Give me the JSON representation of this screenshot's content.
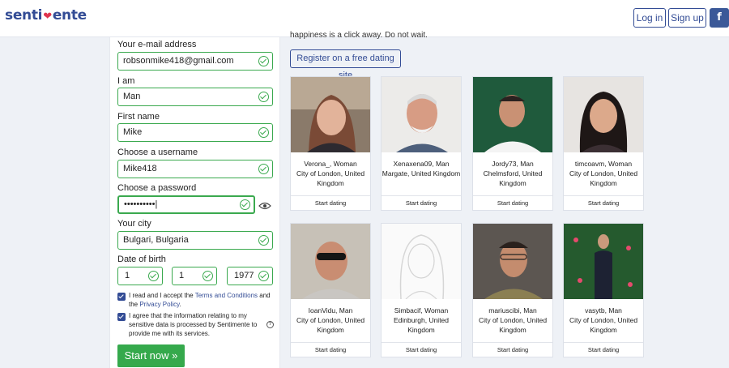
{
  "header": {
    "logo_left": "senti",
    "logo_right": "ente",
    "login_label": "Log in",
    "signup_label": "Sign up",
    "facebook_label": "f"
  },
  "form": {
    "email_label": "Your e-mail address",
    "email_value": "robsonmike418@gmail.com",
    "iam_label": "I am",
    "iam_value": "Man",
    "firstname_label": "First name",
    "firstname_value": "Mike",
    "username_label": "Choose a username",
    "username_value": "Mike418",
    "password_label": "Choose a password",
    "password_value": "••••••••••|",
    "city_label": "Your city",
    "city_value": "Bulgari, Bulgaria",
    "dob_label": "Date of birth",
    "dob_day": "1",
    "dob_month": "1",
    "dob_year": "1977",
    "terms_prefix": "I read and I accept the ",
    "terms_link": "Terms and Conditions",
    "terms_middle": " and the ",
    "privacy_link": "Privacy Policy",
    "terms_suffix": ".",
    "consent_text": "I agree that the information relating to my sensitive data is processed by Sentimente to provide me with its services.",
    "help_label": "?",
    "start_label": "Start now »"
  },
  "main": {
    "tagline": "happiness is a click away. Do not wait.",
    "register_label": "Register on a free dating site",
    "start_dating_label": "Start dating",
    "profiles": [
      {
        "name": "Verona_, Woman",
        "location": "City of London, United Kingdom"
      },
      {
        "name": "Xenaxena09, Man",
        "location": "Margate, United Kingdom"
      },
      {
        "name": "Jordy73, Man",
        "location": "Chelmsford, United Kingdom"
      },
      {
        "name": "timcoavm, Woman",
        "location": "City of London, United Kingdom"
      },
      {
        "name": "IoanVidu, Man",
        "location": "City of London, United Kingdom"
      },
      {
        "name": "Simbacif, Woman",
        "location": "Edinburgh, United Kingdom"
      },
      {
        "name": "mariuscibi, Man",
        "location": "City of London, United Kingdom"
      },
      {
        "name": "vasytb, Man",
        "location": "City of London, United Kingdom"
      }
    ]
  },
  "colors": {
    "brand": "#334c95",
    "accent_green": "#35a94c",
    "heart": "#e0344d",
    "background": "#eef1f6"
  },
  "icons": [
    "check-icon",
    "eye-icon",
    "heart-icon",
    "facebook-icon",
    "help-icon",
    "chevron-double-right-icon"
  ]
}
